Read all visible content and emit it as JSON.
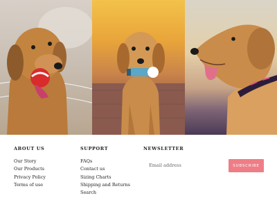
{
  "hero": {
    "panels": [
      {
        "name": "dog-with-ball-outdoors"
      },
      {
        "name": "dog-with-toy-sunset"
      },
      {
        "name": "dog-profile-collar"
      }
    ]
  },
  "footer": {
    "about": {
      "title": "ABOUT US",
      "links": [
        "Our Story",
        "Our Products",
        "Privacy Policy",
        "Terms of use"
      ]
    },
    "support": {
      "title": "SUPPORT",
      "links": [
        "FAQs",
        "Contact us",
        "Sizing Charts",
        "Shipping and Returns",
        "Search"
      ]
    },
    "newsletter": {
      "title": "NEWSLETTER",
      "email_placeholder": "Email address",
      "subscribe_label": "SUBSCRIBE"
    }
  },
  "colors": {
    "accent": "#ef7d86"
  }
}
